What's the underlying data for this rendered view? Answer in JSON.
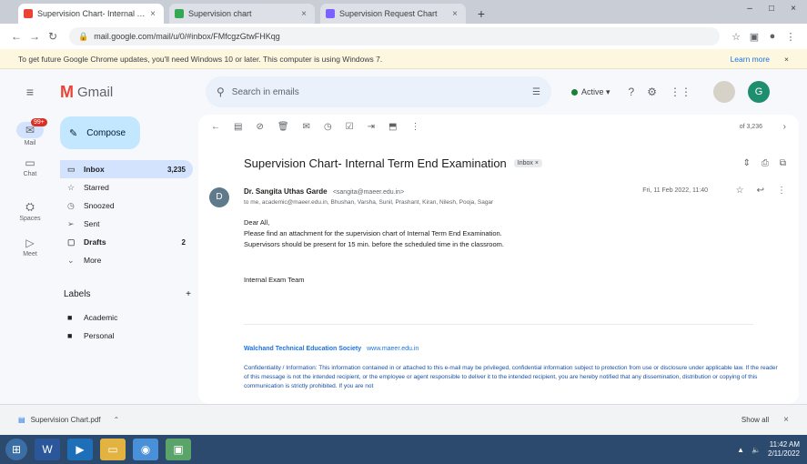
{
  "browser": {
    "tabs": [
      {
        "label": "Supervision Chart- Internal Ter",
        "color": "#ea4335",
        "active": true
      },
      {
        "label": "Supervision chart",
        "color": "#34a853",
        "active": false
      },
      {
        "label": "Supervision Request Chart",
        "color": "#7b61ff",
        "active": false
      }
    ],
    "new_tab": "+",
    "url": "mail.google.com/mail/u/0/#inbox/FMfcgzGtwFHKqg",
    "infobar_text": "To get future Google Chrome updates, you'll need Windows 10 or later. This computer is using Windows 7.",
    "infobar_link": "Learn more"
  },
  "header": {
    "app_name": "Gmail",
    "search_placeholder": "Search in emails",
    "status": "Active",
    "avatar_letter": "G"
  },
  "rail": {
    "mail_label": "Mail",
    "mail_badge": "99+",
    "chat_label": "Chat",
    "spaces_label": "Spaces",
    "meet_label": "Meet"
  },
  "nav": {
    "compose": "Compose",
    "items": [
      {
        "label": "Inbox",
        "count": "3,235"
      },
      {
        "label": "Starred",
        "count": ""
      },
      {
        "label": "Snoozed",
        "count": ""
      },
      {
        "label": "Sent",
        "count": ""
      },
      {
        "label": "Drafts",
        "count": "2"
      },
      {
        "label": "More",
        "count": ""
      }
    ],
    "labels_title": "Labels",
    "labels_add": "+",
    "labels": [
      "Academic",
      "Personal"
    ]
  },
  "message": {
    "pager": "of 3,236",
    "subject": "Supervision Chart- Internal Term End Examination",
    "chip": "Inbox ×",
    "sender_initial": "D",
    "sender_name": "Dr. Sangita Uthas Garde",
    "sender_email": "<sangita@maeer.edu.in>",
    "recipients": "to me, academic@maeer.edu.in, Bhushan, Varsha, Sunil, Prashant, Kiran, Nilesh, Pooja, Sagar",
    "date": "Fri, 11 Feb 2022, 11:40",
    "body": [
      "Dear All,",
      "Please find an attachment for the supervision chart of Internal Term End Examination.",
      "Supervisors should be present for 15 min. before the scheduled time in the classroom."
    ],
    "signature": "Internal Exam Team",
    "footer_org": "Walchand Technical Education Society",
    "footer_link": "www.maeer.edu.in",
    "disclaimer": "Confidentiality / Information: This information contained in or attached to this e-mail may be privileged, confidential information subject to protection from use or disclosure under applicable law. If the reader of this message is not the intended recipient, or the employee or agent responsible to deliver it to the intended recipient, you are hereby notified that any dissemination, distribution or copying of this communication is strictly prohibited. If you are not"
  },
  "downloads": {
    "file": "Supervision Chart.pdf",
    "show_all": "Show all"
  },
  "taskbar": {
    "time": "11:42 AM",
    "date": "2/11/2022"
  }
}
